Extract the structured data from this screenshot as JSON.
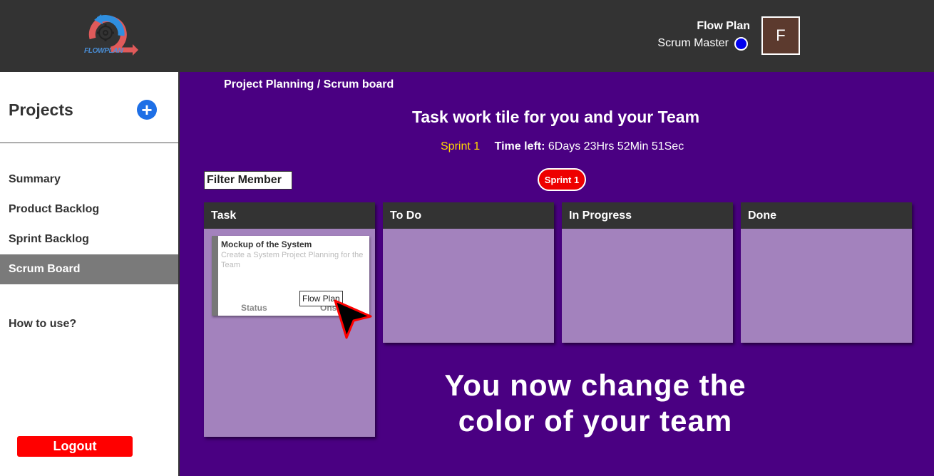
{
  "header": {
    "logo_text": "FLOWPLAN",
    "user_name": "Flow Plan",
    "user_role": "Scrum Master",
    "avatar_initial": "F"
  },
  "sidebar": {
    "title": "Projects",
    "add_label": "+",
    "items": [
      {
        "label": "Summary"
      },
      {
        "label": "Product Backlog"
      },
      {
        "label": "Sprint Backlog"
      },
      {
        "label": "Scrum Board"
      }
    ],
    "help_label": "How to use?",
    "logout_label": "Logout"
  },
  "main": {
    "breadcrumb": "Project Planning / Scrum board",
    "title": "Task work tile for you and your Team",
    "sprint_name": "Sprint 1",
    "time_left_label": "Time left:",
    "time_left_value": "6Days 23Hrs 52Min 51Sec",
    "filter_label": "Filter Member",
    "sprint_badge": "Sprint 1",
    "columns": [
      {
        "label": "Task"
      },
      {
        "label": "To Do"
      },
      {
        "label": "In Progress"
      },
      {
        "label": "Done"
      }
    ],
    "card": {
      "title": "Mockup of the System",
      "description": "Create a System Project Planning for the Team",
      "status_label": "Status",
      "status_value": "Ons",
      "owner": "Flow Plan"
    },
    "overlay_line1": "You now change the",
    "overlay_line2": "color of your team"
  },
  "colors": {
    "background": "#4a0082",
    "header": "#333333",
    "column_body": "#a382bd",
    "accent_red": "#ff0000",
    "sprint_yellow": "#ffd700",
    "role_dot": "#0000ee",
    "avatar": "#5c3a2e"
  }
}
